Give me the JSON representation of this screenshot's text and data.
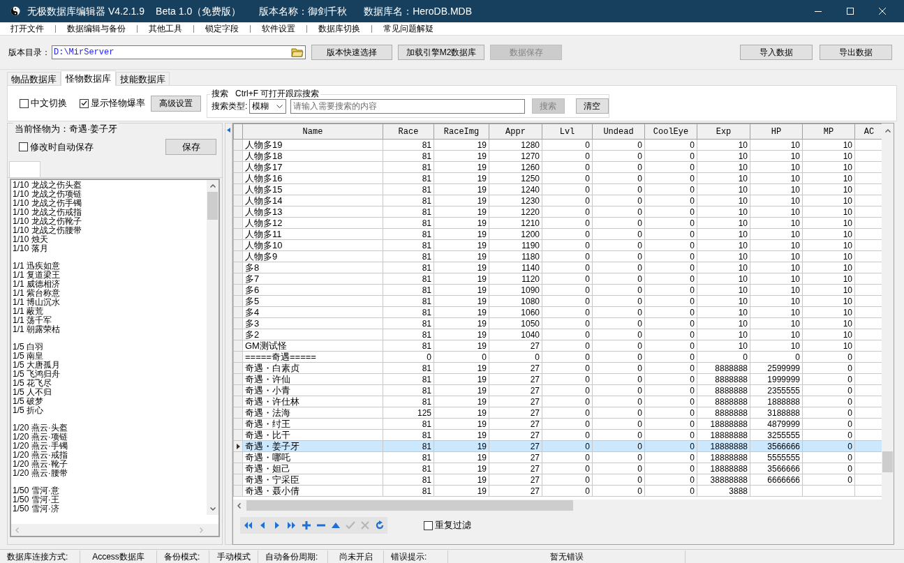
{
  "window": {
    "title": "无极数据库编辑器 V4.2.1.9",
    "edition": "Beta 1.0（免费版）",
    "version_name": "版本名称：御剑千秋",
    "db_name": "数据库名：HeroDB.MDB"
  },
  "menu": [
    "打开文件",
    "数据编辑与备份",
    "其他工具",
    "锁定字段",
    "软件设置",
    "数据库切换",
    "常见问题解疑"
  ],
  "toolbar": {
    "dir_label": "版本目录：",
    "dir_value": "D:\\MirServer",
    "buttons": [
      {
        "label": "版本快速选择",
        "disabled": false
      },
      {
        "label": "加载引擎M2数据库",
        "disabled": false
      },
      {
        "label": "数据保存",
        "disabled": true
      }
    ],
    "right_buttons": [
      {
        "label": "导入数据",
        "disabled": false
      },
      {
        "label": "导出数据",
        "disabled": false
      }
    ]
  },
  "tabs": [
    {
      "label": "物品数据库",
      "selected": false
    },
    {
      "label": "怪物数据库",
      "selected": true
    },
    {
      "label": "技能数据库",
      "selected": false
    }
  ],
  "options": {
    "checkboxes": [
      {
        "label": "中文切换",
        "checked": false
      },
      {
        "label": "显示怪物爆率",
        "checked": true
      }
    ],
    "advanced_button": "高级设置"
  },
  "search": {
    "title": "搜索   Ctrl+F 可打开跟踪搜索",
    "type_label": "搜索类型:",
    "type_value": "模糊",
    "placeholder": "请输入需要搜索的内容",
    "search_button": {
      "label": "搜索",
      "disabled": true
    },
    "clear_button": "清空"
  },
  "monster_panel": {
    "current": "当前怪物为：奇遇·姜子牙",
    "autosave": {
      "label": "修改时自动保存",
      "checked": false
    },
    "save_button": "保存",
    "drop_groups": [
      [
        "1/10 龙战之伤头盔",
        "1/10 龙战之伤项链",
        "1/10 龙战之伤手镯",
        "1/10 龙战之伤戒指",
        "1/10 龙战之伤靴子",
        "1/10 龙战之伤腰带",
        "1/10 烛天",
        "1/10 落月"
      ],
      [
        "1/1 迅疾如意",
        "1/1 复道梁王",
        "1/1 威德相济",
        "1/1 紫台称意",
        "1/1 博山沉水",
        "1/1 蔽荒",
        "1/1 荡千军",
        "1/1 朝露荣枯"
      ],
      [
        "1/5 白羽",
        "1/5 南皇",
        "1/5 大唐孤月",
        "1/5 飞鸿归舟",
        "1/5 花飞尽",
        "1/5 人不归",
        "1/5 破梦",
        "1/5 折心"
      ],
      [
        "1/20 燕云·头盔",
        "1/20 燕云·项链",
        "1/20 燕云·手镯",
        "1/20 燕云·戒指",
        "1/20 燕云·靴子",
        "1/20 燕云·腰带"
      ],
      [
        "1/50 雪河·意",
        "1/50 雪河·王",
        "1/50 雪河·济"
      ]
    ]
  },
  "table": {
    "columns": [
      "Name",
      "Race",
      "RaceImg",
      "Appr",
      "Lvl",
      "Undead",
      "CoolEye",
      "Exp",
      "HP",
      "MP",
      "AC"
    ],
    "rows": [
      {
        "cells": [
          "人物多19",
          "81",
          "19",
          "1280",
          "0",
          "0",
          "0",
          "10",
          "10",
          "10"
        ],
        "selected": false
      },
      {
        "cells": [
          "人物多18",
          "81",
          "19",
          "1270",
          "0",
          "0",
          "0",
          "10",
          "10",
          "10"
        ],
        "selected": false
      },
      {
        "cells": [
          "人物多17",
          "81",
          "19",
          "1260",
          "0",
          "0",
          "0",
          "10",
          "10",
          "10"
        ],
        "selected": false
      },
      {
        "cells": [
          "人物多16",
          "81",
          "19",
          "1250",
          "0",
          "0",
          "0",
          "10",
          "10",
          "10"
        ],
        "selected": false
      },
      {
        "cells": [
          "人物多15",
          "81",
          "19",
          "1240",
          "0",
          "0",
          "0",
          "10",
          "10",
          "10"
        ],
        "selected": false
      },
      {
        "cells": [
          "人物多14",
          "81",
          "19",
          "1230",
          "0",
          "0",
          "0",
          "10",
          "10",
          "10"
        ],
        "selected": false
      },
      {
        "cells": [
          "人物多13",
          "81",
          "19",
          "1220",
          "0",
          "0",
          "0",
          "10",
          "10",
          "10"
        ],
        "selected": false
      },
      {
        "cells": [
          "人物多12",
          "81",
          "19",
          "1210",
          "0",
          "0",
          "0",
          "10",
          "10",
          "10"
        ],
        "selected": false
      },
      {
        "cells": [
          "人物多11",
          "81",
          "19",
          "1200",
          "0",
          "0",
          "0",
          "10",
          "10",
          "10"
        ],
        "selected": false
      },
      {
        "cells": [
          "人物多10",
          "81",
          "19",
          "1190",
          "0",
          "0",
          "0",
          "10",
          "10",
          "10"
        ],
        "selected": false
      },
      {
        "cells": [
          "人物多9",
          "81",
          "19",
          "1180",
          "0",
          "0",
          "0",
          "10",
          "10",
          "10"
        ],
        "selected": false
      },
      {
        "cells": [
          "多8",
          "81",
          "19",
          "1140",
          "0",
          "0",
          "0",
          "10",
          "10",
          "10"
        ],
        "selected": false
      },
      {
        "cells": [
          "多7",
          "81",
          "19",
          "1120",
          "0",
          "0",
          "0",
          "10",
          "10",
          "10"
        ],
        "selected": false
      },
      {
        "cells": [
          "多6",
          "81",
          "19",
          "1090",
          "0",
          "0",
          "0",
          "10",
          "10",
          "10"
        ],
        "selected": false
      },
      {
        "cells": [
          "多5",
          "81",
          "19",
          "1080",
          "0",
          "0",
          "0",
          "10",
          "10",
          "10"
        ],
        "selected": false
      },
      {
        "cells": [
          "多4",
          "81",
          "19",
          "1060",
          "0",
          "0",
          "0",
          "10",
          "10",
          "10"
        ],
        "selected": false
      },
      {
        "cells": [
          "多3",
          "81",
          "19",
          "1050",
          "0",
          "0",
          "0",
          "10",
          "10",
          "10"
        ],
        "selected": false
      },
      {
        "cells": [
          "多2",
          "81",
          "19",
          "1040",
          "0",
          "0",
          "0",
          "10",
          "10",
          "10"
        ],
        "selected": false
      },
      {
        "cells": [
          "GM测试怪",
          "81",
          "19",
          "27",
          "0",
          "0",
          "0",
          "10",
          "10",
          "10"
        ],
        "selected": false
      },
      {
        "cells": [
          "=====奇遇=====",
          "0",
          "0",
          "0",
          "0",
          "0",
          "0",
          "0",
          "0",
          "0"
        ],
        "selected": false
      },
      {
        "cells": [
          "奇遇・白素贞",
          "81",
          "19",
          "27",
          "0",
          "0",
          "0",
          "8888888",
          "2599999",
          "0"
        ],
        "selected": false
      },
      {
        "cells": [
          "奇遇・许仙",
          "81",
          "19",
          "27",
          "0",
          "0",
          "0",
          "8888888",
          "1999999",
          "0"
        ],
        "selected": false
      },
      {
        "cells": [
          "奇遇・小青",
          "81",
          "19",
          "27",
          "0",
          "0",
          "0",
          "8888888",
          "2355555",
          "0"
        ],
        "selected": false
      },
      {
        "cells": [
          "奇遇・许仕林",
          "81",
          "19",
          "27",
          "0",
          "0",
          "0",
          "8888888",
          "1888888",
          "0"
        ],
        "selected": false
      },
      {
        "cells": [
          "奇遇・法海",
          "125",
          "19",
          "27",
          "0",
          "0",
          "0",
          "8888888",
          "3188888",
          "0"
        ],
        "selected": false
      },
      {
        "cells": [
          "奇遇・纣王",
          "81",
          "19",
          "27",
          "0",
          "0",
          "0",
          "18888888",
          "4879999",
          "0"
        ],
        "selected": false
      },
      {
        "cells": [
          "奇遇・比干",
          "81",
          "19",
          "27",
          "0",
          "0",
          "0",
          "18888888",
          "3255555",
          "0"
        ],
        "selected": false
      },
      {
        "cells": [
          "奇遇・姜子牙",
          "81",
          "19",
          "27",
          "0",
          "0",
          "0",
          "18888888",
          "3566666",
          "0"
        ],
        "selected": true
      },
      {
        "cells": [
          "奇遇・哪吒",
          "81",
          "19",
          "27",
          "0",
          "0",
          "0",
          "18888888",
          "5555555",
          "0"
        ],
        "selected": false
      },
      {
        "cells": [
          "奇遇・妲己",
          "81",
          "19",
          "27",
          "0",
          "0",
          "0",
          "18888888",
          "3566666",
          "0"
        ],
        "selected": false
      },
      {
        "cells": [
          "奇遇・宁采臣",
          "81",
          "19",
          "27",
          "0",
          "0",
          "0",
          "38888888",
          "6666666",
          "0"
        ],
        "selected": false
      },
      {
        "cells": [
          "奇遇・聂小倩",
          "81",
          "19",
          "27",
          "0",
          "0",
          "0",
          "3888"
        ],
        "selected": false
      }
    ]
  },
  "nav": [
    {
      "kind": "first",
      "disabled": false
    },
    {
      "kind": "prior",
      "disabled": false
    },
    {
      "kind": "next",
      "disabled": false
    },
    {
      "kind": "last",
      "disabled": false
    },
    {
      "kind": "insert",
      "disabled": false
    },
    {
      "kind": "delete",
      "disabled": false
    },
    {
      "kind": "edit",
      "disabled": false
    },
    {
      "kind": "post",
      "disabled": true
    },
    {
      "kind": "cancel",
      "disabled": true
    },
    {
      "kind": "refresh",
      "disabled": false
    }
  ],
  "filter": {
    "label": "重复过滤",
    "checked": false
  },
  "status_bar": [
    {
      "label": "数据库连接方式:",
      "value": "Access数据库"
    },
    {
      "label": "备份模式:",
      "value": "手动模式"
    },
    {
      "label": "自动备份周期:",
      "value": "尚未开启"
    },
    {
      "label": "错误提示:",
      "value": "暂无错误"
    }
  ]
}
